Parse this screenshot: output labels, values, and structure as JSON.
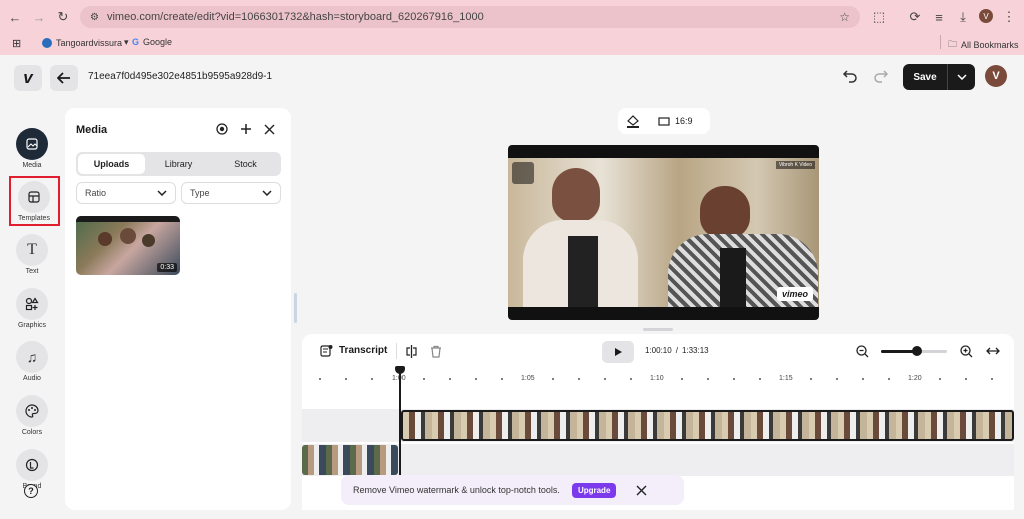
{
  "browser": {
    "url": "vimeo.com/create/edit?vid=1066301732&hash=storyboard_620267916_1000",
    "profile_initial": "V",
    "bookmarks": [
      "Tangoardvissura",
      "Google"
    ],
    "all_bookmarks": "All Bookmarks"
  },
  "header": {
    "logo": "v",
    "project_id": "71eea7f0d495e302e4851b9595a928d9-1",
    "save_label": "Save",
    "avatar_initial": "V"
  },
  "rail": [
    {
      "label": "Media",
      "icon": "image-icon"
    },
    {
      "label": "Templates",
      "icon": "templates-icon"
    },
    {
      "label": "Text",
      "icon": "text-icon"
    },
    {
      "label": "Graphics",
      "icon": "shapes-icon"
    },
    {
      "label": "Audio",
      "icon": "music-icon"
    },
    {
      "label": "Colors",
      "icon": "palette-icon"
    },
    {
      "label": "Brand",
      "icon": "brand-icon"
    }
  ],
  "media": {
    "title": "Media",
    "tabs": [
      "Uploads",
      "Library",
      "Stock"
    ],
    "ratio_label": "Ratio",
    "type_label": "Type",
    "thumb_duration": "0:33"
  },
  "preview": {
    "aspect_label": "16:9",
    "watermark": "vimeo",
    "channel_badge": "Vibroh K Video"
  },
  "timeline": {
    "transcript_label": "Transcript",
    "time_current": "1:00:10",
    "time_total": "1:33:13",
    "time_sep": "/",
    "ticks": [
      "1:00",
      "1:05",
      "1:10",
      "1:15",
      "1:20"
    ],
    "zoom_level": 0.55
  },
  "banner": {
    "text": "Remove Vimeo watermark & unlock top-notch tools.",
    "upgrade_label": "Upgrade"
  },
  "colors": {
    "browser": "#f7d3d9",
    "accent": "#7c3aed",
    "dark": "#1a1a1a",
    "highlight_border": "#e11d2f"
  }
}
